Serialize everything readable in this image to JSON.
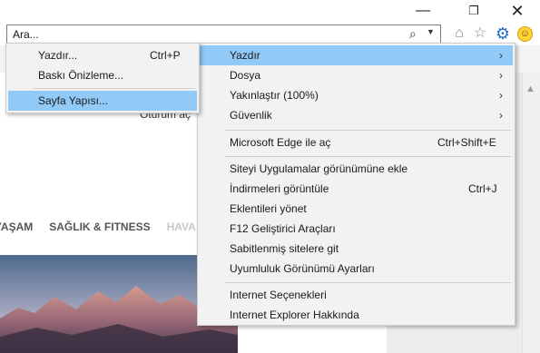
{
  "window": {
    "minimize_glyph": "—",
    "maximize_glyph": "❐",
    "close_glyph": "✕"
  },
  "address_bar": {
    "value": "Ara...",
    "search_glyph": "⌕",
    "dropdown_glyph": "▼"
  },
  "toolbar_icons": {
    "home": {
      "icon": "home-icon",
      "glyph": "⌂"
    },
    "favorites": {
      "icon": "star-icon",
      "glyph": "☆"
    },
    "tools": {
      "icon": "gear-icon",
      "glyph": "⚙"
    },
    "feedback": {
      "icon": "smiley-icon",
      "glyph": "☺"
    }
  },
  "page": {
    "login_text": "Oturum aç",
    "nav": [
      "YAŞAM",
      "SAĞLIK & FITNESS",
      "HAVA"
    ]
  },
  "tools_menu": {
    "items": [
      {
        "label": "Yazdır",
        "submenu": true,
        "highlighted": true
      },
      {
        "label": "Dosya",
        "submenu": true
      },
      {
        "label": "Yakınlaştır (100%)",
        "submenu": true
      },
      {
        "label": "Güvenlik",
        "submenu": true
      },
      {
        "label": "Microsoft Edge ile aç",
        "shortcut": "Ctrl+Shift+E"
      },
      {
        "label": "Siteyi Uygulamalar görünümüne ekle"
      },
      {
        "label": "İndirmeleri görüntüle",
        "shortcut": "Ctrl+J"
      },
      {
        "label": "Eklentileri yönet"
      },
      {
        "label": "F12 Geliştirici Araçları"
      },
      {
        "label": "Sabitlenmiş sitelere git"
      },
      {
        "label": "Uyumluluk Görünümü Ayarları"
      },
      {
        "label": "Internet Seçenekleri"
      },
      {
        "label": "Internet Explorer Hakkında"
      }
    ],
    "submenu_arrow": "›"
  },
  "print_submenu": {
    "items": [
      {
        "label": "Yazdır...",
        "shortcut": "Ctrl+P"
      },
      {
        "label": "Baskı Önizleme..."
      },
      {
        "label": "Sayfa Yapısı...",
        "highlighted": true
      }
    ]
  },
  "colors": {
    "highlight": "#91c9f7",
    "menu_bg": "#f2f2f2",
    "gear": "#1f6fc5"
  }
}
